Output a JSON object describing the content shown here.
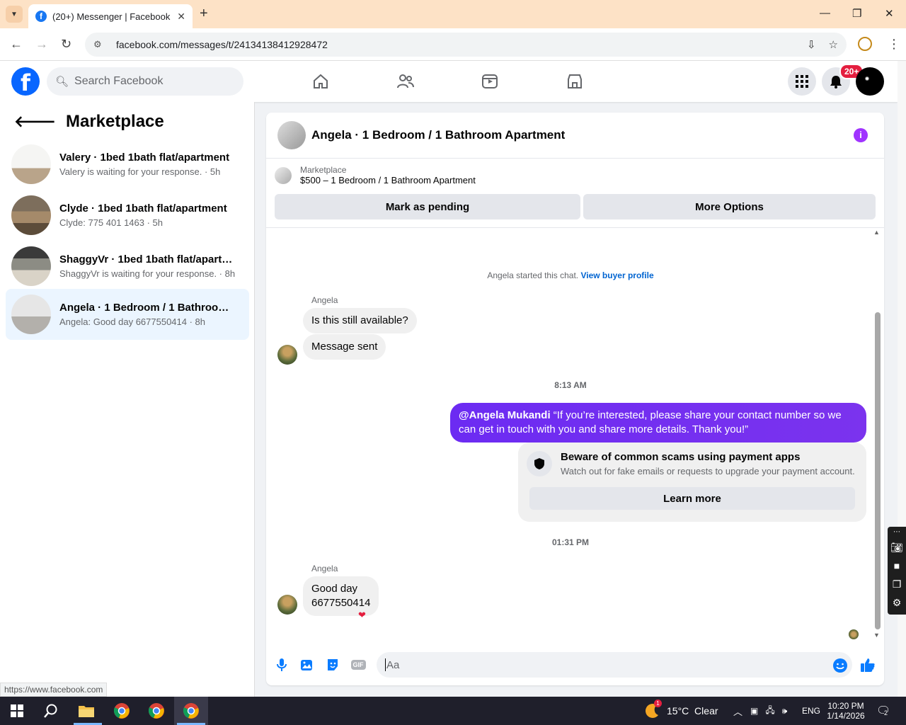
{
  "browser": {
    "tab_title": "(20+) Messenger | Facebook",
    "tab_close": "✕",
    "new_tab": "+",
    "url": "facebook.com/messages/t/24134138412928472",
    "status_url": "https://www.facebook.com"
  },
  "fb": {
    "logo": "f",
    "search_placeholder": "Search Facebook",
    "notif_badge": "20+"
  },
  "sidebar": {
    "title": "Marketplace",
    "conversations": [
      {
        "name": "Valery · 1bed 1bath flat/apartment",
        "preview": "Valery is waiting for your response. · 5h"
      },
      {
        "name": "Clyde · 1bed 1bath flat/apartment",
        "preview": "Clyde: 775 401 1463 · 5h"
      },
      {
        "name": "ShaggyVr · 1bed 1bath flat/apartment",
        "preview": "ShaggyVr is waiting for your response. · 8h"
      },
      {
        "name": "Angela · 1 Bedroom / 1 Bathroom Apartment",
        "preview": "Angela: Good day 6677550414 · 8h"
      }
    ]
  },
  "chat": {
    "title": "Angela · 1 Bedroom / 1 Bathroom Apartment",
    "info_icon": "i",
    "marketplace_label": "Marketplace",
    "listing": "$500 – 1 Bedroom / 1 Bathroom Apartment",
    "mark_pending": "Mark as pending",
    "more_options": "More Options",
    "started_text": "Angela started this chat.",
    "view_profile": "View buyer profile",
    "sender_name": "Angela",
    "msg1": "Is this still available?",
    "msg2": "Message sent",
    "time1": "8:13 AM",
    "out_mention": "@Angela Mukandi",
    "out_text": " “If you’re interested, please share your contact number so we can get in touch with you and share more details. Thank you!”",
    "scam_title": "Beware of common scams using payment apps",
    "scam_desc": "Watch out for fake emails or requests to upgrade your payment account.",
    "learn_more": "Learn more",
    "time2": "01:31 PM",
    "msg3_line1": "Good day",
    "msg3_line2": "6677550414",
    "composer_placeholder": "Aa",
    "gif_label": "GIF"
  },
  "taskbar": {
    "weather": "15°C  Clear",
    "weather_badge": "1",
    "lang": "ENG",
    "time": "10:20 PM",
    "date": "1/14/2026",
    "notif_count": "2"
  },
  "colors": {
    "fb_blue": "#0866ff",
    "outgoing_bubble": "#7433f0",
    "badge_red": "#e41e3f",
    "info_purple": "#a033ff"
  }
}
